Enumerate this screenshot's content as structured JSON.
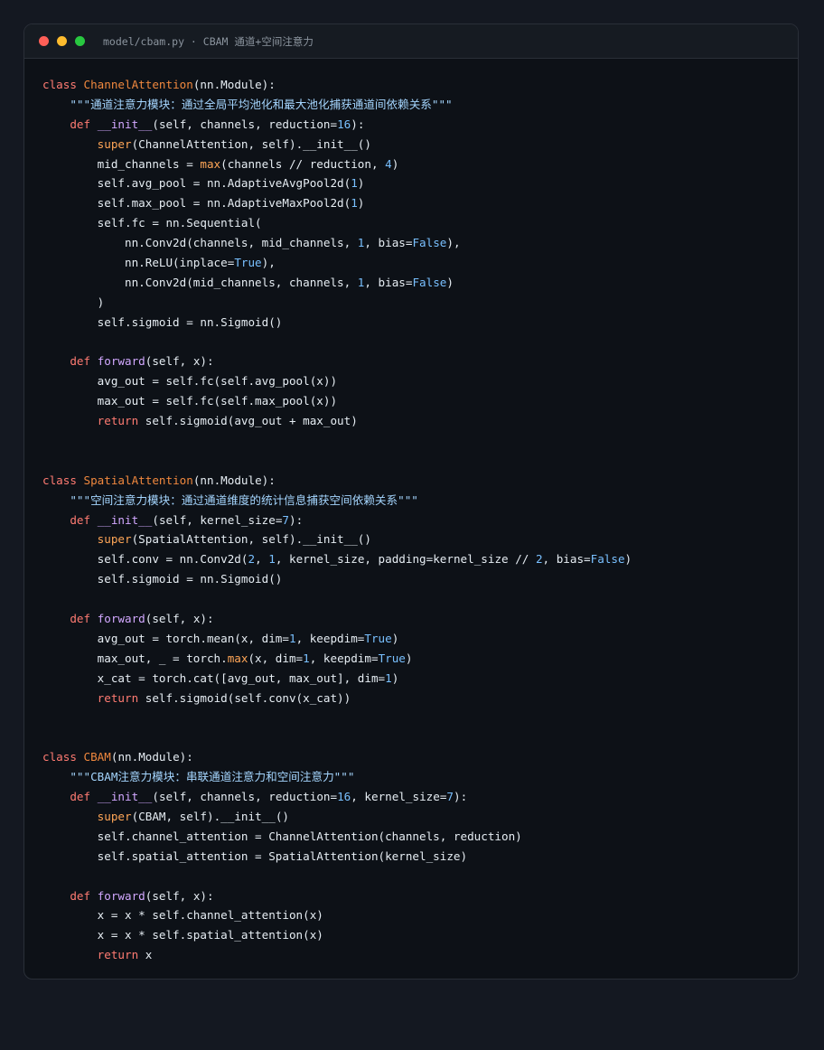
{
  "window": {
    "title": "model/cbam.py · CBAM 通道+空间注意力"
  },
  "code_lines": [
    [
      [
        "k",
        "class"
      ],
      [
        "p",
        " "
      ],
      [
        "c",
        "ChannelAttention"
      ],
      [
        "p",
        "(nn.Module):"
      ]
    ],
    [
      [
        "s",
        "    \"\"\"通道注意力模块：通过全局平均池化和最大池化捕获通道间依赖关系\"\"\""
      ]
    ],
    [
      [
        "p",
        "    "
      ],
      [
        "k",
        "def"
      ],
      [
        "p",
        " "
      ],
      [
        "f",
        "__init__"
      ],
      [
        "p",
        "(self, channels, reduction="
      ],
      [
        "n",
        "16"
      ],
      [
        "p",
        "):"
      ]
    ],
    [
      [
        "p",
        "        "
      ],
      [
        "b",
        "super"
      ],
      [
        "p",
        "(ChannelAttention, self).__init__()"
      ]
    ],
    [
      [
        "p",
        "        mid_channels = "
      ],
      [
        "b",
        "max"
      ],
      [
        "p",
        "(channels // reduction, "
      ],
      [
        "n",
        "4"
      ],
      [
        "p",
        ")"
      ]
    ],
    [
      [
        "p",
        "        self.avg_pool = nn.AdaptiveAvgPool2d("
      ],
      [
        "n",
        "1"
      ],
      [
        "p",
        ")"
      ]
    ],
    [
      [
        "p",
        "        self.max_pool = nn.AdaptiveMaxPool2d("
      ],
      [
        "n",
        "1"
      ],
      [
        "p",
        ")"
      ]
    ],
    [
      [
        "p",
        "        self.fc = nn.Sequential("
      ]
    ],
    [
      [
        "p",
        "            nn.Conv2d(channels, mid_channels, "
      ],
      [
        "n",
        "1"
      ],
      [
        "p",
        ", bias="
      ],
      [
        "n",
        "False"
      ],
      [
        "p",
        "),"
      ]
    ],
    [
      [
        "p",
        "            nn.ReLU(inplace="
      ],
      [
        "n",
        "True"
      ],
      [
        "p",
        "),"
      ]
    ],
    [
      [
        "p",
        "            nn.Conv2d(mid_channels, channels, "
      ],
      [
        "n",
        "1"
      ],
      [
        "p",
        ", bias="
      ],
      [
        "n",
        "False"
      ],
      [
        "p",
        ")"
      ]
    ],
    [
      [
        "p",
        "        )"
      ]
    ],
    [
      [
        "p",
        "        self.sigmoid = nn.Sigmoid()"
      ]
    ],
    [
      [
        "p",
        ""
      ]
    ],
    [
      [
        "p",
        "    "
      ],
      [
        "k",
        "def"
      ],
      [
        "p",
        " "
      ],
      [
        "f",
        "forward"
      ],
      [
        "p",
        "(self, x):"
      ]
    ],
    [
      [
        "p",
        "        avg_out = self.fc(self.avg_pool(x))"
      ]
    ],
    [
      [
        "p",
        "        max_out = self.fc(self.max_pool(x))"
      ]
    ],
    [
      [
        "p",
        "        "
      ],
      [
        "k",
        "return"
      ],
      [
        "p",
        " self.sigmoid(avg_out + max_out)"
      ]
    ],
    [
      [
        "p",
        ""
      ]
    ],
    [
      [
        "p",
        ""
      ]
    ],
    [
      [
        "k",
        "class"
      ],
      [
        "p",
        " "
      ],
      [
        "c",
        "SpatialAttention"
      ],
      [
        "p",
        "(nn.Module):"
      ]
    ],
    [
      [
        "s",
        "    \"\"\"空间注意力模块：通过通道维度的统计信息捕获空间依赖关系\"\"\""
      ]
    ],
    [
      [
        "p",
        "    "
      ],
      [
        "k",
        "def"
      ],
      [
        "p",
        " "
      ],
      [
        "f",
        "__init__"
      ],
      [
        "p",
        "(self, kernel_size="
      ],
      [
        "n",
        "7"
      ],
      [
        "p",
        "):"
      ]
    ],
    [
      [
        "p",
        "        "
      ],
      [
        "b",
        "super"
      ],
      [
        "p",
        "(SpatialAttention, self).__init__()"
      ]
    ],
    [
      [
        "p",
        "        self.conv = nn.Conv2d("
      ],
      [
        "n",
        "2"
      ],
      [
        "p",
        ", "
      ],
      [
        "n",
        "1"
      ],
      [
        "p",
        ", kernel_size, padding=kernel_size // "
      ],
      [
        "n",
        "2"
      ],
      [
        "p",
        ", bias="
      ],
      [
        "n",
        "False"
      ],
      [
        "p",
        ")"
      ]
    ],
    [
      [
        "p",
        "        self.sigmoid = nn.Sigmoid()"
      ]
    ],
    [
      [
        "p",
        ""
      ]
    ],
    [
      [
        "p",
        "    "
      ],
      [
        "k",
        "def"
      ],
      [
        "p",
        " "
      ],
      [
        "f",
        "forward"
      ],
      [
        "p",
        "(self, x):"
      ]
    ],
    [
      [
        "p",
        "        avg_out = torch.mean(x, dim="
      ],
      [
        "n",
        "1"
      ],
      [
        "p",
        ", keepdim="
      ],
      [
        "n",
        "True"
      ],
      [
        "p",
        ")"
      ]
    ],
    [
      [
        "p",
        "        max_out, _ = torch."
      ],
      [
        "b",
        "max"
      ],
      [
        "p",
        "(x, dim="
      ],
      [
        "n",
        "1"
      ],
      [
        "p",
        ", keepdim="
      ],
      [
        "n",
        "True"
      ],
      [
        "p",
        ")"
      ]
    ],
    [
      [
        "p",
        "        x_cat = torch.cat([avg_out, max_out], dim="
      ],
      [
        "n",
        "1"
      ],
      [
        "p",
        ")"
      ]
    ],
    [
      [
        "p",
        "        "
      ],
      [
        "k",
        "return"
      ],
      [
        "p",
        " self.sigmoid(self.conv(x_cat))"
      ]
    ],
    [
      [
        "p",
        ""
      ]
    ],
    [
      [
        "p",
        ""
      ]
    ],
    [
      [
        "k",
        "class"
      ],
      [
        "p",
        " "
      ],
      [
        "c",
        "CBAM"
      ],
      [
        "p",
        "(nn.Module):"
      ]
    ],
    [
      [
        "s",
        "    \"\"\"CBAM注意力模块：串联通道注意力和空间注意力\"\"\""
      ]
    ],
    [
      [
        "p",
        "    "
      ],
      [
        "k",
        "def"
      ],
      [
        "p",
        " "
      ],
      [
        "f",
        "__init__"
      ],
      [
        "p",
        "(self, channels, reduction="
      ],
      [
        "n",
        "16"
      ],
      [
        "p",
        ", kernel_size="
      ],
      [
        "n",
        "7"
      ],
      [
        "p",
        "):"
      ]
    ],
    [
      [
        "p",
        "        "
      ],
      [
        "b",
        "super"
      ],
      [
        "p",
        "(CBAM, self).__init__()"
      ]
    ],
    [
      [
        "p",
        "        self.channel_attention = ChannelAttention(channels, reduction)"
      ]
    ],
    [
      [
        "p",
        "        self.spatial_attention = SpatialAttention(kernel_size)"
      ]
    ],
    [
      [
        "p",
        ""
      ]
    ],
    [
      [
        "p",
        "    "
      ],
      [
        "k",
        "def"
      ],
      [
        "p",
        " "
      ],
      [
        "f",
        "forward"
      ],
      [
        "p",
        "(self, x):"
      ]
    ],
    [
      [
        "p",
        "        x = x * self.channel_attention(x)"
      ]
    ],
    [
      [
        "p",
        "        x = x * self.spatial_attention(x)"
      ]
    ],
    [
      [
        "p",
        "        "
      ],
      [
        "k",
        "return"
      ],
      [
        "p",
        " x"
      ]
    ]
  ]
}
